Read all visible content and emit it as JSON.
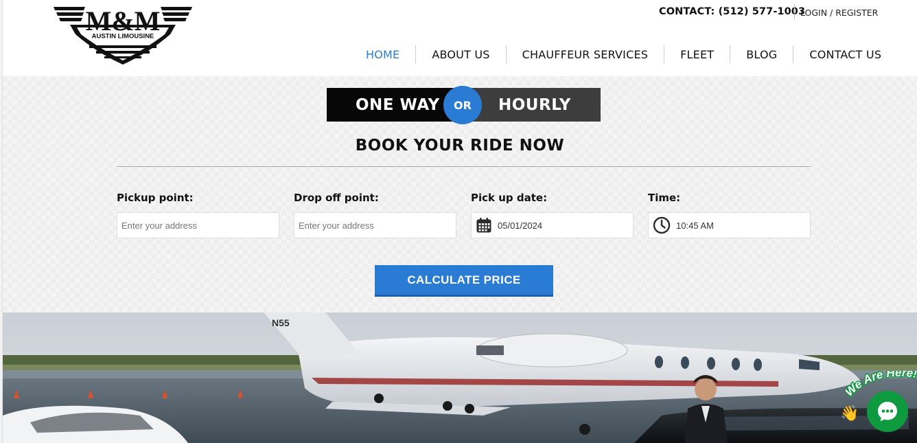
{
  "header": {
    "logo_text": "M&M",
    "logo_subtitle": "AUSTIN LIMOUSINE",
    "contact": "CONTACT: (512) 577-1003",
    "login": "LOGIN / REGISTER",
    "nav": [
      "HOME",
      "ABOUT US",
      "CHAUFFEUR SERVICES",
      "FLEET",
      "BLOG",
      "CONTACT US"
    ],
    "active_nav": "HOME"
  },
  "booking": {
    "toggle_one_way": "ONE WAY",
    "toggle_or": "OR",
    "toggle_hourly": "HOURLY",
    "title": "BOOK YOUR RIDE NOW",
    "fields": [
      {
        "label": "Pickup point:",
        "placeholder": "Enter your address",
        "value": ""
      },
      {
        "label": "Drop off point:",
        "placeholder": "Enter your address",
        "value": ""
      },
      {
        "label": "Pick up date:",
        "placeholder": "",
        "value": "05/01/2024",
        "icon": "calendar-icon"
      },
      {
        "label": "Time:",
        "placeholder": "",
        "value": "10:45 AM",
        "icon": "clock-icon"
      }
    ],
    "calculate_label": "CALCULATE PRICE"
  },
  "hero": {
    "tail_number": "N55"
  },
  "chat": {
    "teaser": "We Are Here!",
    "icon": "chat-icon",
    "wave": "👋"
  },
  "colors": {
    "accent": "#2a7bd4",
    "chat": "#0e9a3f"
  }
}
